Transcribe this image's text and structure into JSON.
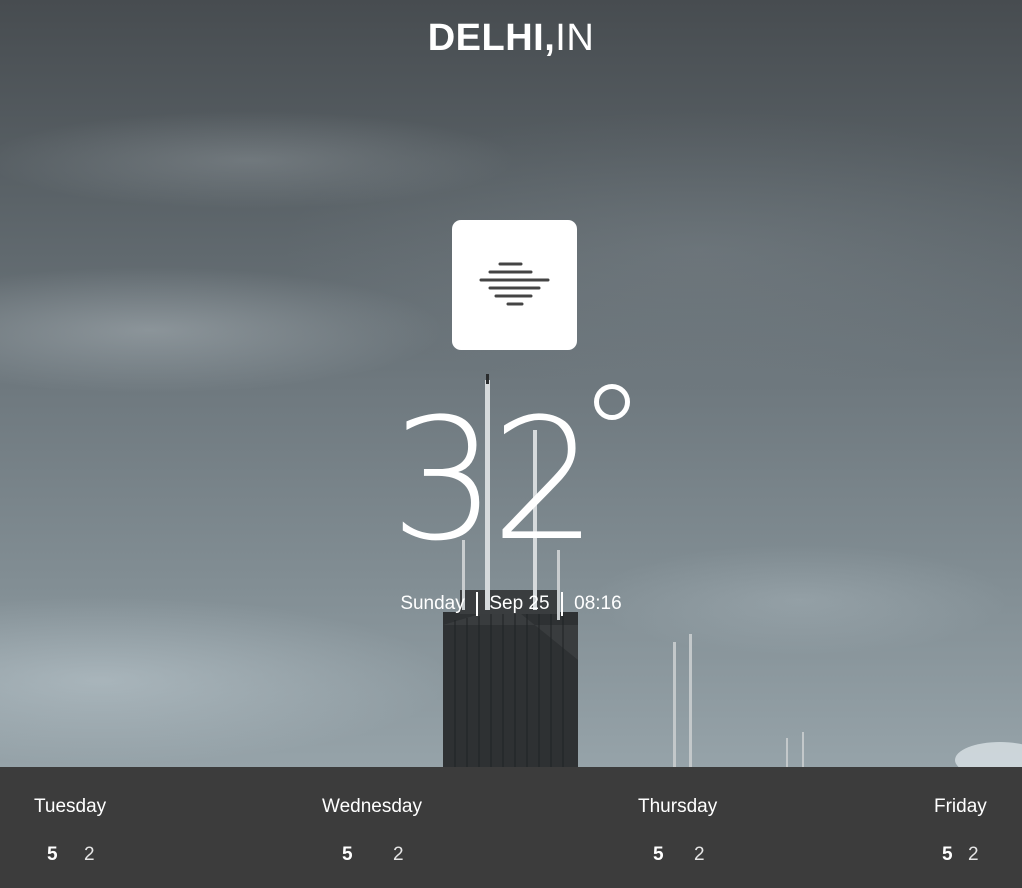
{
  "location": {
    "city": "DELHI,",
    "country": "IN"
  },
  "current": {
    "icon": "fog-mist-icon",
    "temperature": "32",
    "degree_symbol": "°",
    "day": "Sunday",
    "date": "Sep 25",
    "time": "08:16"
  },
  "forecast": [
    {
      "day": "Tuesday",
      "high": "5",
      "low": "2"
    },
    {
      "day": "Wednesday",
      "high": "5",
      "low": "2"
    },
    {
      "day": "Thursday",
      "high": "5",
      "low": "2"
    },
    {
      "day": "Friday",
      "high": "5",
      "low": "2"
    }
  ],
  "colors": {
    "forecast_bar": "#3c3c3c",
    "icon_box": "#ffffff",
    "icon_stroke": "#444444",
    "text": "#ffffff"
  }
}
